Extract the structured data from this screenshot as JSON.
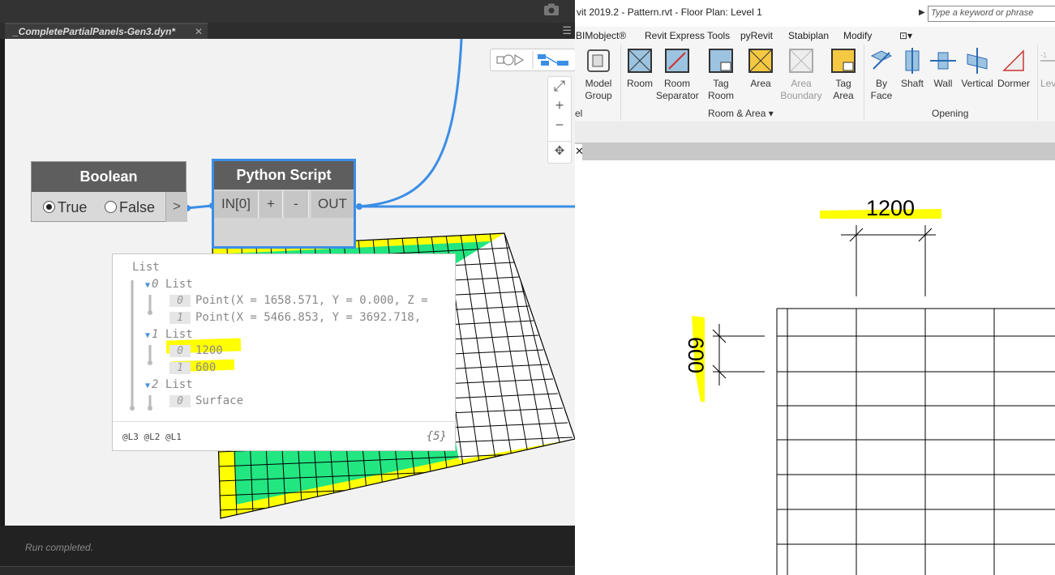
{
  "dynamo": {
    "tab_title": "_CompletePartialPanels-Gen3.dyn*",
    "tab_close": "✕",
    "status": "Run completed.",
    "zoom_fit": "⤢",
    "zoom_in": "+",
    "zoom_out": "−",
    "pan": "✥",
    "bool_node": {
      "title": "Boolean",
      "true_label": "True",
      "false_label": "False",
      "output": ">",
      "selected": "True"
    },
    "python_node": {
      "title": "Python Script",
      "input_port": "IN[0]",
      "add": "+",
      "remove": "-",
      "output_port": "OUT"
    },
    "preview": {
      "root": "List",
      "rows": [
        {
          "level": 1,
          "index": "0",
          "text": "List"
        },
        {
          "level": 2,
          "index": "0",
          "text": "Point(X = 1658.571, Y = 0.000, Z ="
        },
        {
          "level": 2,
          "index": "1",
          "text": "Point(X = 5466.853, Y = 3692.718,"
        },
        {
          "level": 1,
          "index": "1",
          "text": "List"
        },
        {
          "level": 2,
          "index": "0",
          "text": "1200"
        },
        {
          "level": 2,
          "index": "1",
          "text": "600"
        },
        {
          "level": 1,
          "index": "2",
          "text": "List"
        },
        {
          "level": 2,
          "index": "0",
          "text": "Surface"
        }
      ],
      "levels": "@L3 @L2 @L1",
      "count": "{5}"
    }
  },
  "revit": {
    "title": "vit 2019.2 - Pattern.rvt - Floor Plan: Level 1",
    "search_placeholder": "Type a keyword or phrase",
    "menu": [
      "BIMobject®",
      "Revit Express Tools",
      "pyRevit",
      "Stabiplan",
      "Modify"
    ],
    "ribbon": {
      "model_group": "Model\nGroup",
      "room": "Room",
      "room_separator": "Room\nSeparator",
      "tag_room": "Tag\nRoom",
      "area": "Area",
      "area_boundary": "Area\nBoundary",
      "tag_area": "Tag\nArea",
      "by_face": "By\nFace",
      "shaft": "Shaft",
      "wall": "Wall",
      "vertical": "Vertical",
      "dormer": "Dormer",
      "level": "Lev",
      "panel_left": "el",
      "panel_room_area": "Room & Area",
      "panel_opening": "Opening"
    },
    "viewtab_close": "✕",
    "dims": {
      "horizontal": "1200",
      "vertical": "600"
    },
    "colors": {
      "highlight": "#ffff00",
      "panel_green": "#22e680",
      "wire_blue": "#3b8ee6"
    }
  }
}
